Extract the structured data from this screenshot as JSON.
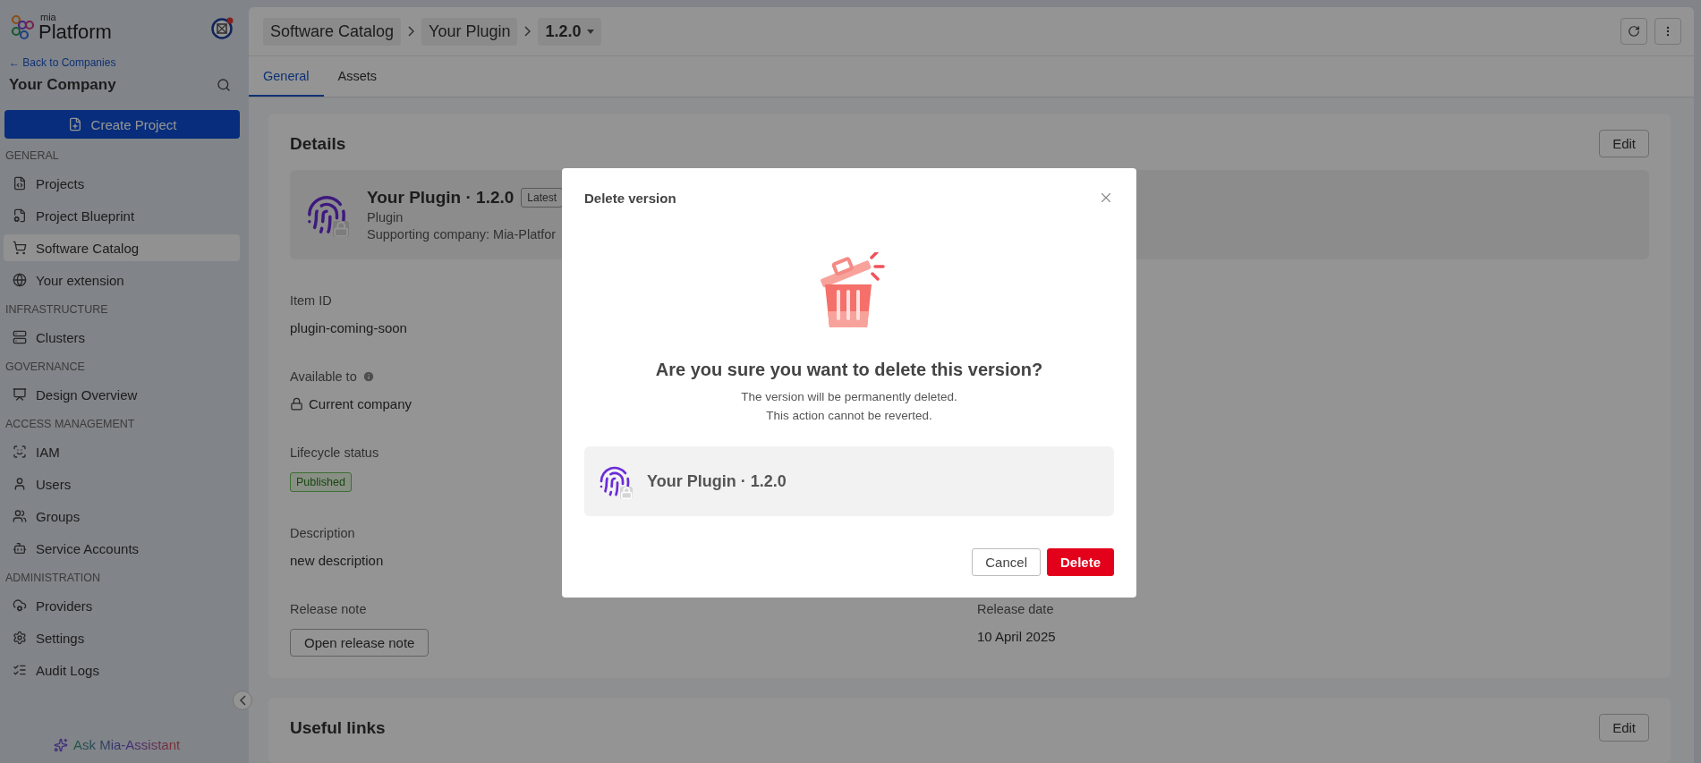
{
  "sidebar": {
    "logo": {
      "small": "mia",
      "big": "Platform"
    },
    "back_link": "← Back to Companies",
    "company": "Your Company",
    "create_button": "Create Project",
    "sections": [
      {
        "title": "GENERAL",
        "items": [
          {
            "label": "Projects",
            "selected": false
          },
          {
            "label": "Project Blueprint",
            "selected": false
          },
          {
            "label": "Software Catalog",
            "selected": true
          },
          {
            "label": "Your extension",
            "selected": false
          }
        ]
      },
      {
        "title": "INFRASTRUCTURE",
        "items": [
          {
            "label": "Clusters",
            "selected": false
          }
        ]
      },
      {
        "title": "GOVERNANCE",
        "items": [
          {
            "label": "Design Overview",
            "selected": false
          }
        ]
      },
      {
        "title": "ACCESS MANAGEMENT",
        "items": [
          {
            "label": "IAM",
            "selected": false
          },
          {
            "label": "Users",
            "selected": false
          },
          {
            "label": "Groups",
            "selected": false
          },
          {
            "label": "Service Accounts",
            "selected": false
          }
        ]
      },
      {
        "title": "ADMINISTRATION",
        "items": [
          {
            "label": "Providers",
            "selected": false
          },
          {
            "label": "Settings",
            "selected": false
          },
          {
            "label": "Audit Logs",
            "selected": false
          }
        ]
      }
    ],
    "assistant": "Ask Mia-Assistant"
  },
  "header": {
    "breadcrumbs": [
      {
        "label": "Software Catalog",
        "kind": "crumb"
      },
      {
        "label": "Your Plugin",
        "kind": "crumb"
      },
      {
        "label": "1.2.0",
        "kind": "dropdown"
      }
    ],
    "tabs": [
      {
        "label": "General",
        "selected": true
      },
      {
        "label": "Assets",
        "selected": false
      }
    ]
  },
  "details": {
    "title": "Details",
    "edit": "Edit",
    "plugin": {
      "name": "Your Plugin · 1.2.0",
      "badge": "Latest",
      "type": "Plugin",
      "supporting": "Supporting company:  Mia-Platfor"
    },
    "cells": [
      {
        "label": "Item ID",
        "value": "plugin-coming-soon",
        "kind": "text"
      },
      {
        "label": "Available to",
        "value": "Current company",
        "kind": "lock",
        "info": true
      },
      {
        "label": "Lifecycle status",
        "value": "Published",
        "kind": "tag"
      },
      {
        "label": "Description",
        "value": "new description",
        "kind": "text"
      },
      {
        "label": "Release note",
        "value": "Open release note",
        "kind": "button"
      },
      {
        "label": "Release date",
        "value": "10 April 2025",
        "kind": "text"
      }
    ]
  },
  "links": {
    "title": "Useful links",
    "edit": "Edit"
  },
  "modal": {
    "title": "Delete version",
    "heading": "Are you sure you want to delete this version?",
    "message": [
      "The version will be permanently deleted.",
      "This action cannot be reverted."
    ],
    "item": "Your Plugin · 1.2.0",
    "buttons": [
      {
        "label": "Cancel",
        "kind": "secondary"
      },
      {
        "label": "Delete",
        "kind": "danger"
      }
    ]
  }
}
